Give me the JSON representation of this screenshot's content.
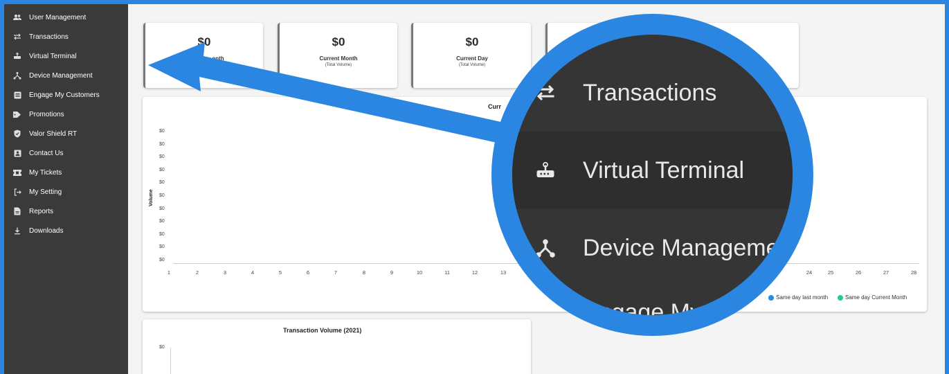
{
  "sidebar": {
    "items": [
      {
        "label": "User Management",
        "icon": "users-icon"
      },
      {
        "label": "Transactions",
        "icon": "swap-arrows-icon"
      },
      {
        "label": "Virtual Terminal",
        "icon": "terminal-icon"
      },
      {
        "label": "Device Management",
        "icon": "device-tree-icon"
      },
      {
        "label": "Engage My Customers",
        "icon": "card-icon"
      },
      {
        "label": "Promotions",
        "icon": "tag-icon"
      },
      {
        "label": "Valor Shield RT",
        "icon": "shield-icon"
      },
      {
        "label": "Contact Us",
        "icon": "contact-card-icon"
      },
      {
        "label": "My Tickets",
        "icon": "ticket-icon"
      },
      {
        "label": "My Setting",
        "icon": "setting-icon"
      },
      {
        "label": "Reports",
        "icon": "report-icon"
      },
      {
        "label": "Downloads",
        "icon": "download-icon"
      }
    ]
  },
  "cards": [
    {
      "amount": "$0",
      "title": "onth",
      "subtitle": "olume)"
    },
    {
      "amount": "$0",
      "title": "Current Month",
      "subtitle": "(Total Volume)"
    },
    {
      "amount": "$0",
      "title": "Current Day",
      "subtitle": "(Total Volume)"
    }
  ],
  "panel1": {
    "title": "Curr",
    "ylabel": "Volume",
    "yticks": [
      "$0",
      "$0",
      "$0",
      "$0",
      "$0",
      "$0",
      "$0",
      "$0",
      "$0",
      "$0",
      "$0"
    ],
    "xticks_left": [
      "1",
      "2",
      "3",
      "4",
      "5",
      "6",
      "7",
      "8",
      "9",
      "10",
      "11",
      "12",
      "13"
    ],
    "xticks_right": [
      "24",
      "25",
      "26",
      "27",
      "28"
    ],
    "legend": [
      {
        "label": "Same day last month",
        "color": "#1f8de6"
      },
      {
        "label": "Same day Current Month",
        "color": "#22cc88"
      }
    ]
  },
  "panel2": {
    "title": "Transaction Volume (2021)",
    "ytick": "$0"
  },
  "magnifier": {
    "items": [
      {
        "label": "Transactions",
        "icon": "swap-arrows-icon"
      },
      {
        "label": "Virtual Terminal",
        "icon": "terminal-icon"
      },
      {
        "label": "Device Managemer",
        "icon": "device-tree-icon"
      },
      {
        "label": "Engage My C",
        "icon": "card-icon"
      }
    ]
  },
  "colors": {
    "frame": "#2a86e0",
    "sidebar": "#3a3a3a",
    "arrow": "#2a86e0"
  }
}
